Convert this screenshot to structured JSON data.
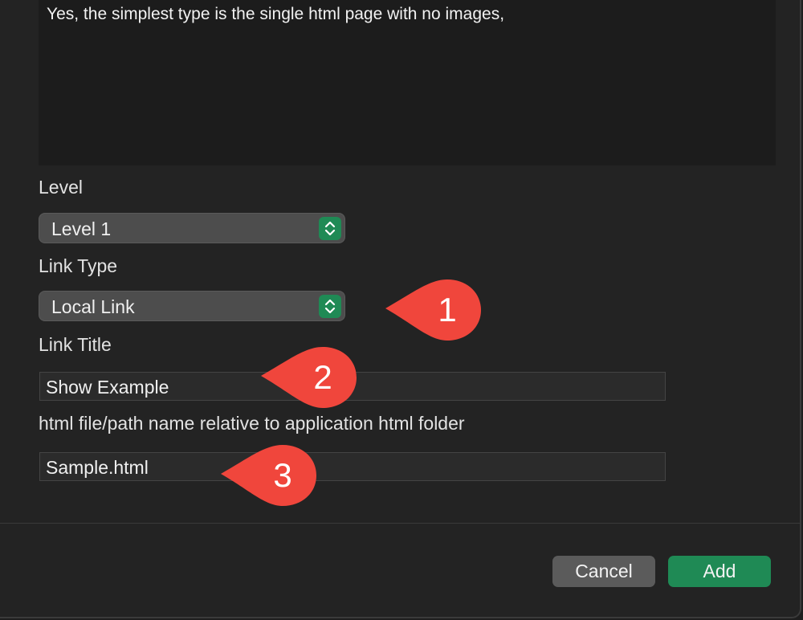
{
  "description_text": "Yes, the simplest type is the single html page with no images,",
  "level": {
    "label": "Level",
    "value": "Level 1"
  },
  "link_type": {
    "label": "Link Type",
    "value": "Local Link"
  },
  "link_title": {
    "label": "Link Title",
    "value": "Show Example"
  },
  "html_path": {
    "label": "html file/path name relative to application html folder",
    "value": "Sample.html"
  },
  "buttons": {
    "cancel": "Cancel",
    "add": "Add"
  },
  "callouts": [
    "1",
    "2",
    "3"
  ],
  "colors": {
    "accent": "#1f8a55",
    "callout": "#f0463c"
  },
  "icons": {
    "stepper": "chevron-updown-icon"
  }
}
